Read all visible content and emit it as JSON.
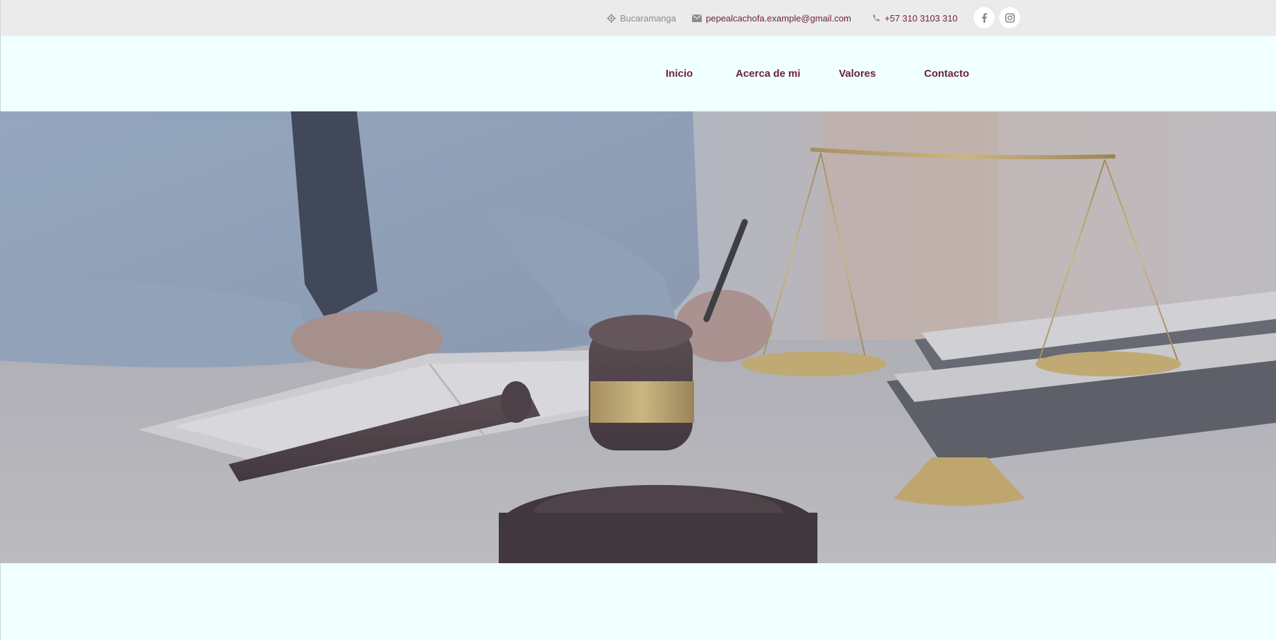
{
  "topbar": {
    "location": {
      "icon": "location-crosshair-icon",
      "text": "Bucaramanga"
    },
    "email": {
      "icon": "envelope-icon",
      "text": "pepealcachofa.example@gmail.com"
    },
    "phone": {
      "icon": "phone-icon",
      "text": "+57 310 3103 310"
    },
    "social": [
      {
        "icon": "facebook-icon"
      },
      {
        "icon": "instagram-icon"
      }
    ]
  },
  "nav": {
    "items": [
      {
        "label": "Inicio"
      },
      {
        "label": "Acerca de mi"
      },
      {
        "label": "Valores"
      },
      {
        "label": "Contacto"
      }
    ]
  },
  "hero": {
    "image": "lawyer-desk-gavel-scales-image"
  },
  "colors": {
    "accent": "#6b1f3c",
    "topbar_bg": "#ebebeb",
    "header_bg": "#f0ffff",
    "muted_text": "#8a8a8a"
  }
}
